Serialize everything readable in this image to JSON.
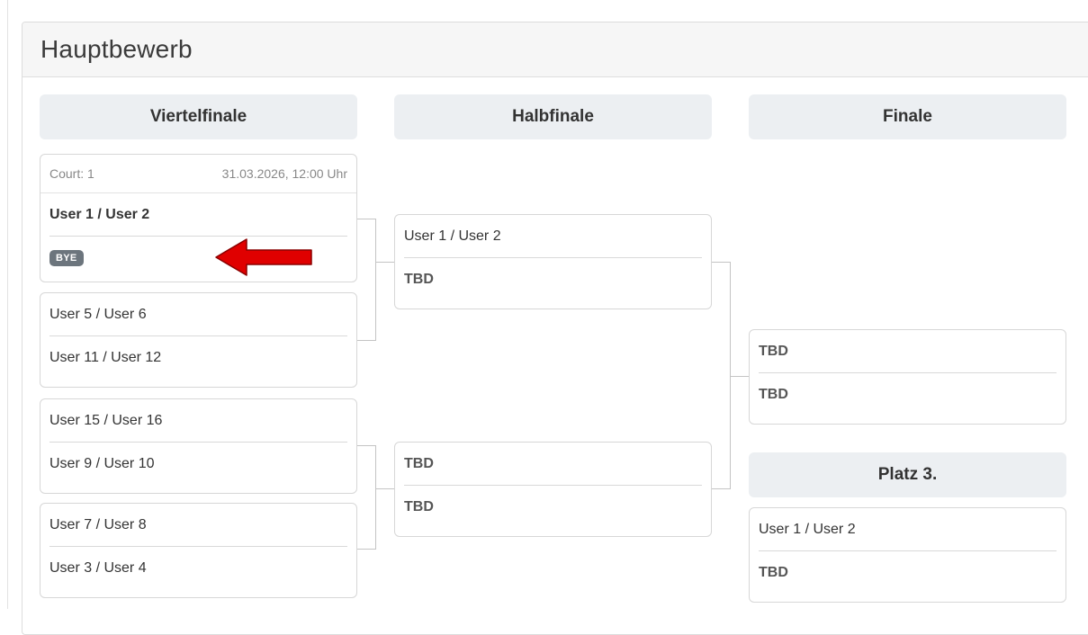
{
  "panel": {
    "title": "Hauptbewerb"
  },
  "rounds": [
    {
      "label": "Viertelfinale"
    },
    {
      "label": "Halbfinale"
    },
    {
      "label": "Finale"
    }
  ],
  "third_place": {
    "label": "Platz 3."
  },
  "quarterfinals": [
    {
      "court": "Court: 1",
      "datetime": "31.03.2026, 12:00 Uhr",
      "team_a": "User 1 / User 2",
      "team_b": "BYE"
    },
    {
      "team_a": "User 5 / User 6",
      "team_b": "User 11 / User 12"
    },
    {
      "team_a": "User 15 / User 16",
      "team_b": "User 9 / User 10"
    },
    {
      "team_a": "User 7 / User 8",
      "team_b": "User 3 / User 4"
    }
  ],
  "semifinals": [
    {
      "team_a": "User 1 / User 2",
      "team_b": "TBD"
    },
    {
      "team_a": "TBD",
      "team_b": "TBD"
    }
  ],
  "final": {
    "team_a": "TBD",
    "team_b": "TBD"
  },
  "third_place_match": {
    "team_a": "User 1 / User 2",
    "team_b": "TBD"
  },
  "annotation": {
    "arrow_color": "#e00000"
  }
}
